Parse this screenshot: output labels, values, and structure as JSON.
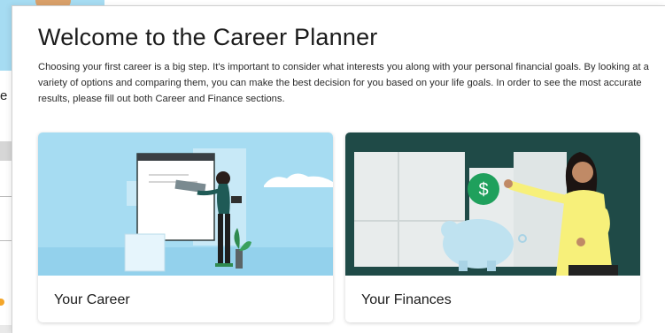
{
  "background": {
    "partial_text": "e"
  },
  "modal": {
    "title": "Welcome to the Career Planner",
    "intro": "Choosing your first career is a big step. It's important to consider what interests you along with your personal financial goals. By looking at a variety of options and comparing them, you can make the best decision for you based on your life goals. In order to see the most accurate results, please fill out both Career and Finance sections."
  },
  "cards": {
    "career": {
      "label": "Your Career",
      "illustration": "person-writing-on-whiteboard",
      "accent": "#a6dcf2"
    },
    "finance": {
      "label": "Your Finances",
      "illustration": "person-with-piggy-bank",
      "coin_symbol": "$",
      "accent": "#1f4a47",
      "coin_color": "#1fa05c"
    }
  },
  "colors": {
    "career_bg": "#a6dcf2",
    "finance_bg": "#1f4a47",
    "shirt_yellow": "#f7f07a",
    "teal_shirt": "#1f5a56"
  }
}
